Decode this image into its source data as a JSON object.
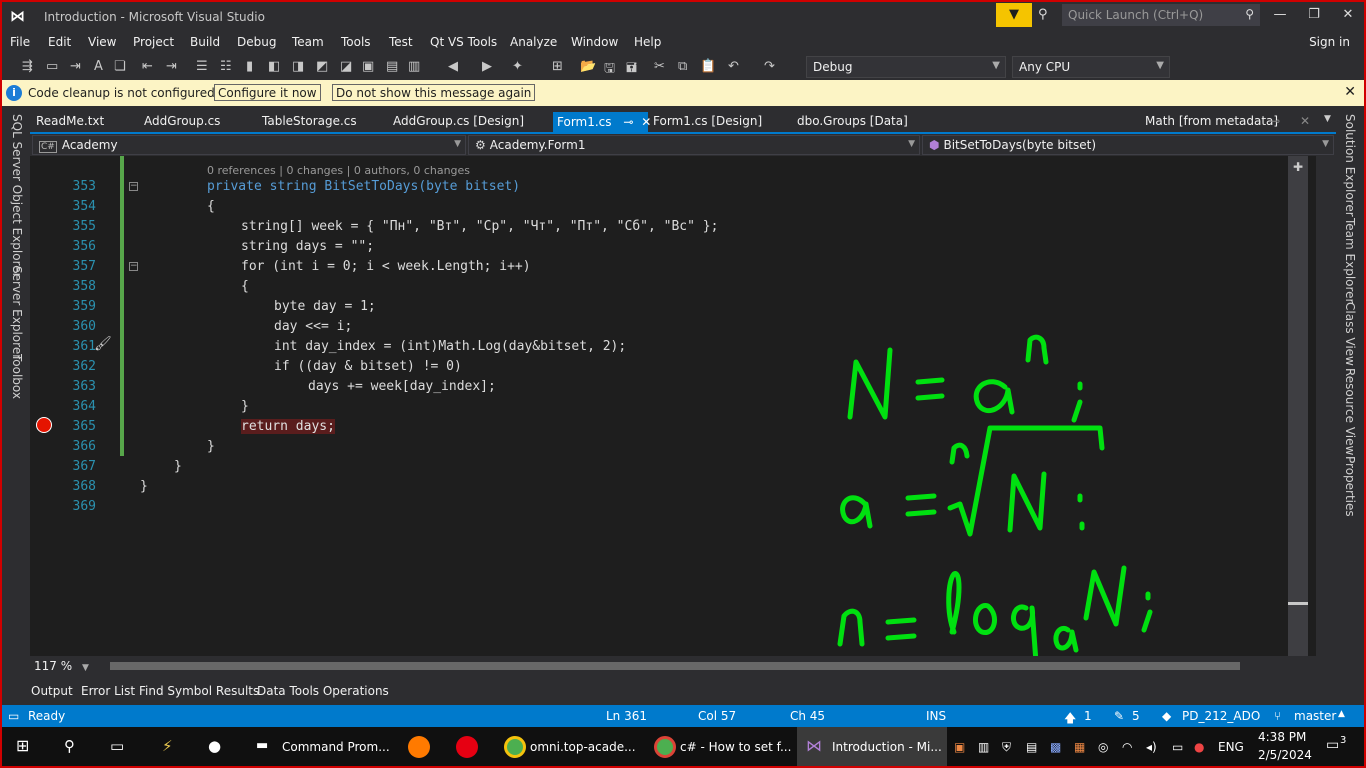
{
  "window": {
    "title": "Introduction - Microsoft Visual Studio",
    "quick_launch_placeholder": "Quick Launch (Ctrl+Q)"
  },
  "menu": [
    "File",
    "Edit",
    "View",
    "Project",
    "Build",
    "Debug",
    "Team",
    "Tools",
    "Test",
    "Qt VS Tools",
    "Analyze",
    "Window",
    "Help"
  ],
  "sign_in": "Sign in",
  "toolbar": {
    "config": "Debug",
    "platform": "Any CPU"
  },
  "infobar": {
    "message": "Code cleanup is not configured",
    "configure": "Configure it now",
    "dismiss": "Do not show this message again"
  },
  "side_left": [
    "SQL Server Object Explorer",
    "Server Explorer",
    "Toolbox"
  ],
  "side_right": [
    "Solution Explorer",
    "Team Explorer",
    "Class View",
    "Resource View",
    "Properties"
  ],
  "tabs": [
    "ReadMe.txt",
    "AddGroup.cs",
    "TableStorage.cs",
    "AddGroup.cs [Design]",
    "Form1.cs",
    "Form1.cs [Design]",
    "dbo.Groups [Data]",
    "Math [from metadata]"
  ],
  "nav": {
    "project": "Academy",
    "class": "Academy.Form1",
    "member": "BitSetToDays(byte bitset)"
  },
  "codelens": "0 references | 0 changes | 0 authors, 0 changes",
  "line_numbers": [
    "353",
    "354",
    "355",
    "356",
    "357",
    "358",
    "359",
    "360",
    "361",
    "362",
    "363",
    "364",
    "365",
    "366",
    "367",
    "368",
    "369"
  ],
  "code": {
    "l353": "private string BitSetToDays(byte bitset)",
    "l354": "{",
    "l355": "string[] week = { \"Пн\", \"Вт\", \"Ср\", \"Чт\", \"Пт\", \"Сб\", \"Вс\" };",
    "l356": "string days = \"\";",
    "l357": "for (int i = 0; i < week.Length; i++)",
    "l358": "{",
    "l359": "byte day = 1;",
    "l360": "day <<= i;",
    "l361": "int day_index = (int)Math.Log(day&bitset, 2);",
    "l362": "if ((day & bitset) != 0)",
    "l363": "days += week[day_index];",
    "l364": "}",
    "l365": "return days;",
    "l366": "}",
    "l367": "}",
    "l368": "}"
  },
  "zoom": "117 %",
  "bottom_tabs": [
    "Output",
    "Error List",
    "Find Symbol Results",
    "Data Tools Operations"
  ],
  "status": {
    "state": "Ready",
    "ln": "Ln 361",
    "col": "Col 57",
    "ch": "Ch 45",
    "mode": "INS",
    "up": "1",
    "edits": "5",
    "repo": "PD_212_ADO",
    "branch": "master"
  },
  "taskbar": {
    "items": [
      "Command Prom...",
      "omni.top-acade...",
      "c# - How to set f...",
      "Introduction - Mi..."
    ],
    "lang": "ENG",
    "time": "4:38 PM",
    "date": "2/5/2024",
    "notif": "3"
  },
  "colors": {
    "accent": "#007acc",
    "frame": "#d00000",
    "ink": "#00e010"
  }
}
